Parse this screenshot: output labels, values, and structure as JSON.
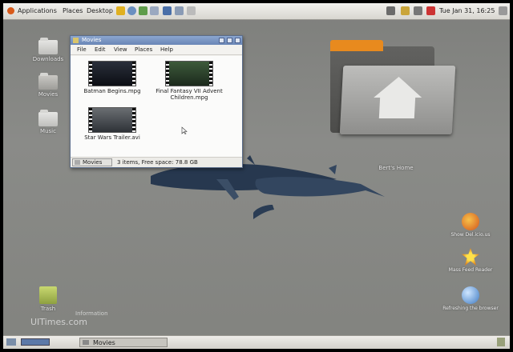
{
  "top_panel": {
    "menus": [
      "Applications",
      "Places",
      "Desktop"
    ],
    "clock": "Tue Jan 31, 16:25"
  },
  "desktop": {
    "icons_left": [
      {
        "label": "Downloads"
      },
      {
        "label": "Movies"
      },
      {
        "label": "Music"
      },
      {
        "label": "Trash"
      }
    ],
    "home_folder_label": "Bert's Home",
    "icons_right": [
      {
        "label": "Show Del.icio.us"
      },
      {
        "label": "Mass Feed Reader"
      },
      {
        "label": "Refreshing the browser"
      }
    ]
  },
  "file_window": {
    "title": "Movies",
    "menus": [
      "File",
      "Edit",
      "View",
      "Places",
      "Help"
    ],
    "files": [
      {
        "name": "Batman Begins.mpg"
      },
      {
        "name": "Final Fantasy VII Advent Children.mpg"
      },
      {
        "name": "Star Wars Trailer.avi"
      }
    ],
    "location": "Movies",
    "status": "3 items, Free space: 78.8 GB"
  },
  "bottom_panel": {
    "task": "Movies"
  },
  "watermark": {
    "text": "UITimes.com",
    "sub": "Information"
  }
}
